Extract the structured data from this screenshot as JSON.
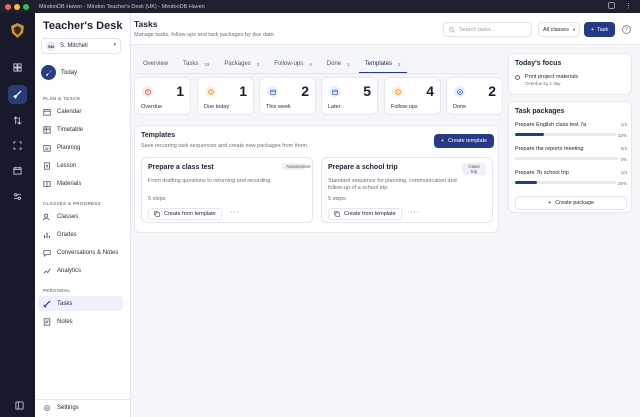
{
  "window": {
    "title": "MindooDB Haven - Mindoo Teacher's Desk (UK) - MindooDB Haven"
  },
  "sidebar": {
    "app_name": "Teacher's Desk",
    "user": {
      "initials": "SM",
      "name": "S. Mitchell"
    },
    "today_label": "Today",
    "sections": {
      "plan": "PLAN & TEACH",
      "classes": "CLASSES & PROGRESS",
      "personal": "PERSONAL"
    },
    "items": {
      "calendar": "Calendar",
      "timetable": "Timetable",
      "planning": "Planning",
      "lesson": "Lesson",
      "materials": "Materials",
      "classes": "Classes",
      "grades": "Grades",
      "conversations": "Conversations & Notes",
      "analytics": "Analytics",
      "tasks": "Tasks",
      "notes": "Notes"
    },
    "settings": "Settings"
  },
  "header": {
    "title": "Tasks",
    "subtitle": "Manage tasks, follow-ups and task packages by due date.",
    "search_placeholder": "Search tasks...",
    "class_filter": "All classes",
    "task_button": "Task"
  },
  "tabs": [
    {
      "label": "Overview",
      "count": ""
    },
    {
      "label": "Tasks",
      "count": "19"
    },
    {
      "label": "Packages",
      "count": "3"
    },
    {
      "label": "Follow-ups",
      "count": "4"
    },
    {
      "label": "Done",
      "count": "2"
    },
    {
      "label": "Templates",
      "count": "2"
    }
  ],
  "stats": [
    {
      "label": "Overdue",
      "value": "1",
      "icon": "alert-icon",
      "color": "#d1473f",
      "bg": "#fde9e7"
    },
    {
      "label": "Due today",
      "value": "1",
      "icon": "clock-icon",
      "color": "#e08a1e",
      "bg": "#fdf1e0"
    },
    {
      "label": "This week",
      "value": "2",
      "icon": "calendar-icon",
      "color": "#3d63c9",
      "bg": "#e8eefb"
    },
    {
      "label": "Later",
      "value": "5",
      "icon": "calendar-icon",
      "color": "#3d63c9",
      "bg": "#e8eefb"
    },
    {
      "label": "Follow-ups",
      "value": "4",
      "icon": "bell-icon",
      "color": "#e08a1e",
      "bg": "#fdf1e0"
    },
    {
      "label": "Done",
      "value": "2",
      "icon": "check-circle-icon",
      "color": "#3d63c9",
      "bg": "#e8eefb"
    }
  ],
  "templates": {
    "title": "Templates",
    "description": "Save recurring task sequences and create new packages from them.",
    "create_button": "Create template",
    "cards": [
      {
        "title": "Prepare a class test",
        "tag": "Assessment",
        "description": "From drafting questions to returning and recording.",
        "steps": "5 steps",
        "action": "Create from template",
        "more": "···"
      },
      {
        "title": "Prepare a school trip",
        "tag": "Class trip",
        "description": "Standard sequence for planning, communication and follow-up of a school trip.",
        "steps": "5 steps",
        "action": "Create from template",
        "more": "···"
      }
    ]
  },
  "focus": {
    "title": "Today's focus",
    "item": "Print project materials",
    "sub": "Overdue by 1 day"
  },
  "packages": {
    "title": "Task packages",
    "items": [
      {
        "name": "Prepare English class test 7a",
        "count": "1/3",
        "percent": "33%",
        "progress": 0.33
      },
      {
        "name": "Prepare the reports meeting",
        "count": "0/3",
        "percent": "0%",
        "progress": 0
      },
      {
        "name": "Prepare 7b school trip",
        "count": "1/4",
        "percent": "25%",
        "progress": 0.25
      }
    ],
    "create_button": "Create package"
  }
}
